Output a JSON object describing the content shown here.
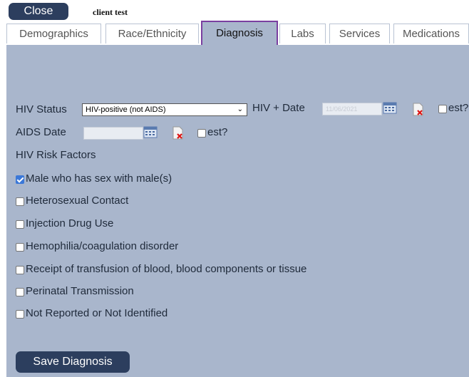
{
  "header": {
    "close_label": "Close",
    "client_name": "client test"
  },
  "tabs": [
    {
      "label": "Demographics"
    },
    {
      "label": "Race/Ethnicity"
    },
    {
      "label": "Diagnosis",
      "active": true
    },
    {
      "label": "Labs"
    },
    {
      "label": "Services"
    },
    {
      "label": "Medications"
    }
  ],
  "diagnosis": {
    "hiv_status_label": "HIV Status",
    "hiv_status_value": "HIV-positive (not AIDS)",
    "hiv_date_label": "HIV + Date",
    "hiv_date_value": "11/06/2021",
    "hiv_est_label": "est?",
    "aids_date_label": "AIDS Date",
    "aids_date_value": "",
    "aids_est_label": "est?",
    "risk_factors_label": "HIV Risk Factors",
    "risk_factors": [
      {
        "label": "Male who has sex with male(s)",
        "checked": true
      },
      {
        "label": "Heterosexual Contact",
        "checked": false
      },
      {
        "label": "Injection Drug Use",
        "checked": false
      },
      {
        "label": "Hemophilia/coagulation disorder",
        "checked": false
      },
      {
        "label": "Receipt of transfusion of blood, blood components or tissue",
        "checked": false
      },
      {
        "label": "Perinatal Transmission",
        "checked": false
      },
      {
        "label": "Not Reported or Not Identified",
        "checked": false
      }
    ],
    "save_label": "Save Diagnosis"
  },
  "colors": {
    "panel": "#a9b6cc",
    "button": "#2c3e5e",
    "active_tab_border": "#7a3fa0",
    "checkbox_checked": "#3b78d8"
  },
  "icons": {
    "calendar": "calendar-icon",
    "clear": "clear-date-icon"
  }
}
